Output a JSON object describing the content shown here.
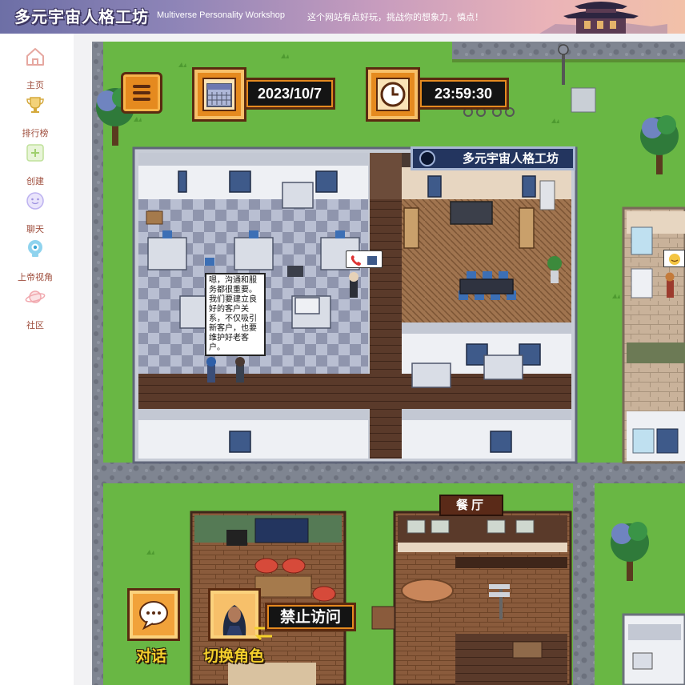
{
  "header": {
    "brand": "多元宇宙人格工坊",
    "brand_en": "Multiverse Personality Workshop",
    "slogan": "这个网站有点好玩，挑战你的想象力，慎点！"
  },
  "sidebar": {
    "items": [
      {
        "label": "主页",
        "icon": "home-icon"
      },
      {
        "label": "排行榜",
        "icon": "trophy-icon"
      },
      {
        "label": "创建",
        "icon": "plus-icon"
      },
      {
        "label": "聊天",
        "icon": "chat-face-icon"
      },
      {
        "label": "上帝视角",
        "icon": "camera-icon"
      },
      {
        "label": "社区",
        "icon": "planet-icon"
      }
    ]
  },
  "hud": {
    "date": "2023/10/7",
    "time": "23:59:30"
  },
  "scene": {
    "office_sign": "多元宇宙人格工坊",
    "restaurant_sign": "餐厅",
    "speech": "嗯，沟通和服务都很重要。我们要建立良好的客户关系，不仅吸引新客户，也要维护好老客户。"
  },
  "actions": {
    "talk_label": "对话",
    "switch_label": "切换角色",
    "forbid_label": "禁止访问"
  },
  "colors": {
    "grass": "#69b744",
    "path": "#7f8591",
    "hud_orange": "#e58a1f",
    "hud_dark": "#141414",
    "label_yellow": "#f5d02c",
    "sidebar_text": "#a0503f"
  }
}
